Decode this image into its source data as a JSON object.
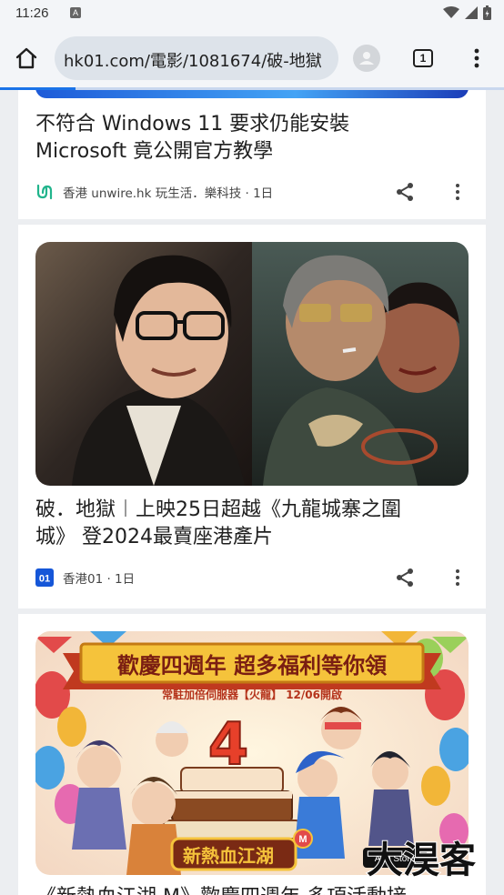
{
  "status_bar": {
    "time": "11:26",
    "notification_letter": "A"
  },
  "browser": {
    "url": "hk01.com/電影/1081674/破-地獄",
    "tab_count": "1",
    "load_progress": 0.15
  },
  "articles": [
    {
      "title_line1": "不符合 Windows 11 要求仍能安裝",
      "title_line2": "Microsoft 竟公開官方教學",
      "source": "香港 unwire.hk 玩生活．樂科技 · 1日"
    },
    {
      "title_line1": "破．地獄︱上映25日超越《九龍城寨之圍",
      "title_line2": "城》 登2024最賣座港產片",
      "source": "香港01 · 1日",
      "source_logo_text": "01"
    },
    {
      "banner_headline": "歡慶四週年 超多福利等你領",
      "banner_subline": "常駐加倍伺服器【火龍】 12/06開啟",
      "banner_number": "4",
      "banner_game_logo": "新熱血江湖",
      "banner_badge": "M",
      "banner_store": "App Store",
      "title_line1": "《新熱血江湖 M》歡慶四週年 多項活動接"
    }
  ],
  "watermark_text": "大淏客",
  "colors": {
    "accent": "#1a73e8",
    "card_bg": "#ffffff",
    "page_bg": "#eceef1"
  }
}
